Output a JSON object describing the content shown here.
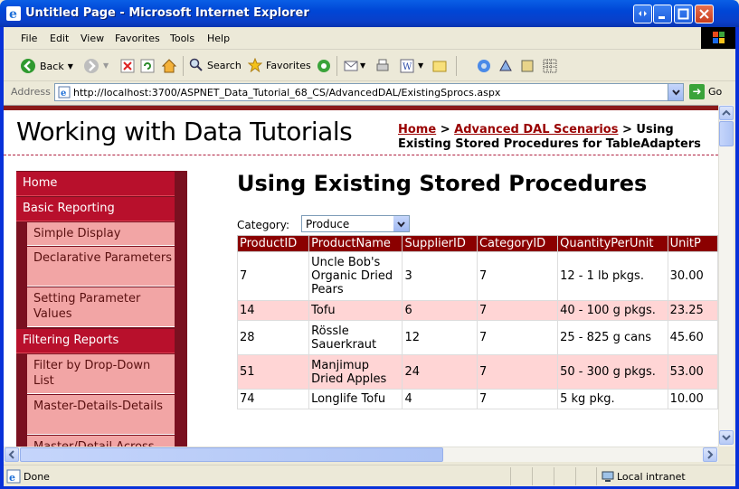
{
  "window": {
    "title": "Untitled Page - Microsoft Internet Explorer"
  },
  "menu": [
    "File",
    "Edit",
    "View",
    "Favorites",
    "Tools",
    "Help"
  ],
  "toolbar": {
    "back": "Back",
    "search": "Search",
    "favorites": "Favorites"
  },
  "address": {
    "label": "Address",
    "url": "http://localhost:3700/ASPNET_Data_Tutorial_68_CS/AdvancedDAL/ExistingSprocs.aspx",
    "go": "Go"
  },
  "site": {
    "title": "Working with Data Tutorials"
  },
  "breadcrumb": {
    "home": "Home",
    "sep1": " > ",
    "section": "Advanced DAL Scenarios",
    "sep2": " > Using",
    "current": "Existing Stored Procedures for TableAdapters"
  },
  "sidebar": {
    "home": "Home",
    "basic": "Basic Reporting",
    "simple": "Simple Display",
    "declarative": "Declarative Parameters",
    "setting": "Setting Parameter Values",
    "filtering": "Filtering Reports",
    "filterdd": "Filter by Drop-Down List",
    "masterdetails": "Master-Details-Details",
    "masteracross": "Master/Detail Across"
  },
  "main": {
    "heading": "Using Existing Stored Procedures",
    "category_label": "Category:",
    "category_value": "Produce"
  },
  "grid": {
    "headers": [
      "ProductID",
      "ProductName",
      "SupplierID",
      "CategoryID",
      "QuantityPerUnit",
      "UnitP"
    ],
    "rows": [
      [
        "7",
        "Uncle Bob's Organic Dried Pears",
        "3",
        "7",
        "12 - 1 lb pkgs.",
        "30.00"
      ],
      [
        "14",
        "Tofu",
        "6",
        "7",
        "40 - 100 g pkgs.",
        "23.25"
      ],
      [
        "28",
        "Rössle Sauerkraut",
        "12",
        "7",
        "25 - 825 g cans",
        "45.60"
      ],
      [
        "51",
        "Manjimup Dried Apples",
        "24",
        "7",
        "50 - 300 g pkgs.",
        "53.00"
      ],
      [
        "74",
        "Longlife Tofu",
        "4",
        "7",
        "5 kg pkg.",
        "10.00"
      ]
    ]
  },
  "status": {
    "left": "Done",
    "zone": "Local intranet"
  }
}
